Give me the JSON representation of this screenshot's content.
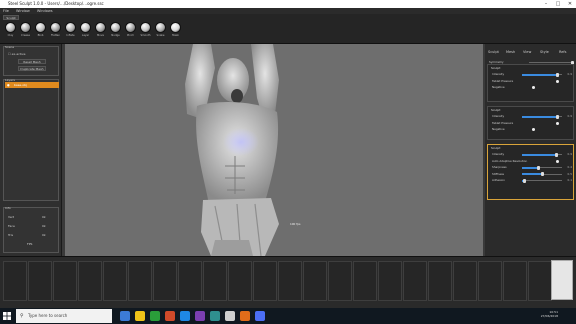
{
  "window": {
    "title": "Steel Sculpt 1.0.0 - Users/…/Desktop/…ogre.ssc",
    "controls": [
      "–",
      "□",
      "✕"
    ]
  },
  "menubar": {
    "items": [
      "File",
      "Window",
      "Windows"
    ]
  },
  "toolbar": {
    "tab_label": "Sculpt",
    "brushes": [
      {
        "label": "Clay",
        "color": "#b8b8b8"
      },
      {
        "label": "Crease",
        "color": "#a9a9a9"
      },
      {
        "label": "Blob",
        "color": "#bdbdbd"
      },
      {
        "label": "Flatten",
        "color": "#a0a0a0"
      },
      {
        "label": "Inflate",
        "color": "#b0b0b0"
      },
      {
        "label": "Layer",
        "color": "#c0c0c0"
      },
      {
        "label": "Move",
        "color": "#a8a8a8"
      },
      {
        "label": "Nudge",
        "color": "#b5b5b5"
      },
      {
        "label": "Pinch",
        "color": "#9e9e9e"
      },
      {
        "label": "Smooth",
        "color": "#c4c4c4"
      },
      {
        "label": "Snake",
        "color": "#adadad"
      },
      {
        "label": "Mask",
        "color": "#d8d8d8"
      }
    ]
  },
  "left_panel": {
    "objects_header": "Scene",
    "object_name": "ex-active",
    "btn_reset": "Reset Mesh",
    "btn_dup": "Duplicate Mesh",
    "layers_header": "Layers",
    "layer_name": "base-obj",
    "stats_header": "Info",
    "stats": [
      {
        "k": "Vert",
        "v": "0k"
      },
      {
        "k": "Face",
        "v": "0k"
      },
      {
        "k": "Tris",
        "v": "0k"
      }
    ],
    "fps": "FPS"
  },
  "viewport": {
    "caption": "100 fps"
  },
  "right_panel": {
    "tabs": [
      "Sculpt",
      "Mesh",
      "View",
      "Style",
      "Refs"
    ],
    "top_row": {
      "label": "Symmetry",
      "value": ""
    },
    "sections": [
      {
        "title": "Sculpt",
        "rows": [
          {
            "label": "Intensity",
            "value": "0.9",
            "frac": 0.88
          },
          {
            "label": "Tablet Pressure",
            "value": "",
            "frac": null
          },
          {
            "label": "Negative",
            "value": "",
            "frac": null
          }
        ]
      },
      {
        "title": "Sculpt",
        "rows": [
          {
            "label": "Intensity",
            "value": "0.9",
            "frac": 0.88
          },
          {
            "label": "Tablet Pressure",
            "value": "",
            "frac": null
          },
          {
            "label": "Negative",
            "value": "",
            "frac": null
          }
        ]
      },
      {
        "title": "Sculpt",
        "rows": [
          {
            "label": "Intensity",
            "value": "0.9",
            "frac": 0.86
          },
          {
            "label": "Auto Adaptive Resolution",
            "value": "",
            "frac": null
          },
          {
            "label": "Sharpness",
            "value": "0.4",
            "frac": 0.4
          },
          {
            "label": "Stiffness",
            "value": "0.5",
            "frac": 0.5
          },
          {
            "label": "Adhesion",
            "value": "0.1",
            "frac": 0.05
          }
        ]
      }
    ]
  },
  "taskbar": {
    "search_placeholder": "Type here to search",
    "time": "10:51",
    "date": "27/06/2018",
    "icon_colors": [
      "#3c7bd6",
      "#f0c419",
      "#2a9d3a",
      "#d04a2a",
      "#1e88e5",
      "#7b3fb0",
      "#2f8f8f",
      "#cfcfcf",
      "#e06c1a",
      "#4c6ef5"
    ]
  },
  "colors": {
    "accent": "#d9a43a",
    "slider": "#3a8be0"
  }
}
